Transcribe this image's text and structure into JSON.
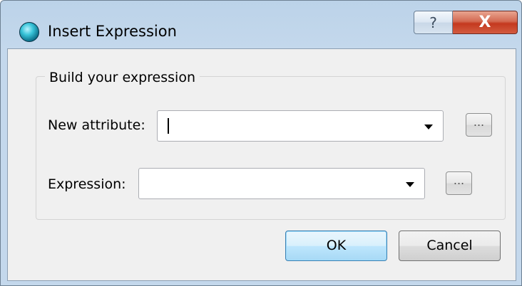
{
  "window": {
    "title": "Insert Expression",
    "help_label": "?",
    "close_label": "X"
  },
  "group": {
    "title": "Build your expression"
  },
  "form": {
    "new_attribute_label": "New attribute:",
    "new_attribute_value": "",
    "expression_label": "Expression:",
    "expression_value": "",
    "browse_label": "..."
  },
  "buttons": {
    "ok_label": "OK",
    "cancel_label": "Cancel"
  }
}
